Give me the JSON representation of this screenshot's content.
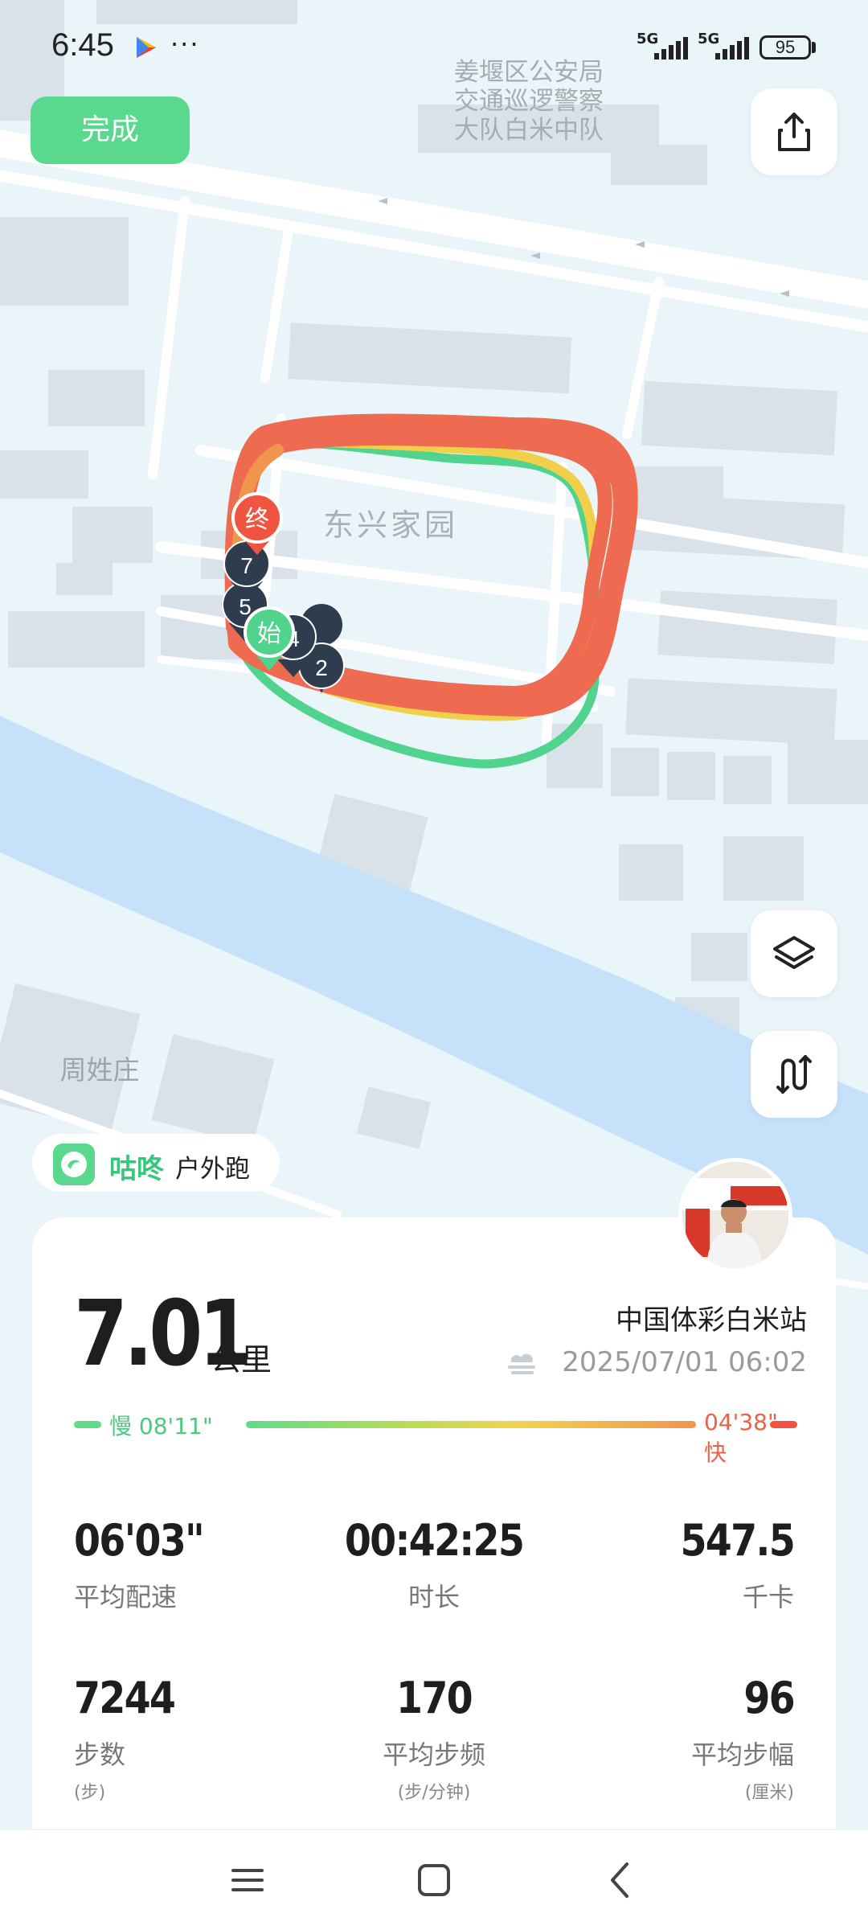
{
  "status_bar": {
    "time": "6:45",
    "more": "···",
    "signal_1_tag": "5G",
    "signal_2_tag": "5G",
    "battery": "95"
  },
  "top": {
    "done_label": "完成",
    "share_icon": "share-icon"
  },
  "map": {
    "labels": {
      "police": [
        "姜堰区公安局",
        "交通巡逻警察",
        "大队白米中队"
      ],
      "community": "东兴家园",
      "village": "周姓庄"
    },
    "markers": {
      "end": "终",
      "start": "始",
      "km": [
        "7",
        "5",
        "4",
        "2"
      ]
    },
    "colors": {
      "route_fast": "#ee6a50",
      "route_mid": "#f0d04a",
      "route_slow": "#4fd38d",
      "river": "#c6e2fb",
      "marker_dark": "#2f3c4e"
    },
    "layers_icon": "layers-icon",
    "route_icon": "route-icon"
  },
  "activity": {
    "app_name": "咕咚",
    "type": "户外跑",
    "distance": "7.01",
    "distance_unit": "公里",
    "location": "中国体彩白米站",
    "datetime": "2025/07/01 06:02",
    "weather_icon": "cloudy-icon",
    "pace_slow": "慢 08'11\"",
    "pace_fast": "04'38\" 快"
  },
  "stats": {
    "pace": {
      "value": "06'03\"",
      "label": "平均配速"
    },
    "duration": {
      "value": "00:42:25",
      "label": "时长"
    },
    "calories": {
      "value": "547.5",
      "label": "千卡"
    },
    "steps": {
      "value": "7244",
      "label": "步数",
      "unit": "(步)"
    },
    "cadence": {
      "value": "170",
      "label": "平均步频",
      "unit": "(步/分钟)"
    },
    "stride": {
      "value": "96",
      "label": "平均步幅",
      "unit": "(厘米)"
    }
  },
  "colors": {
    "accent_green": "#59d88e",
    "fast_red": "#e8634a"
  }
}
